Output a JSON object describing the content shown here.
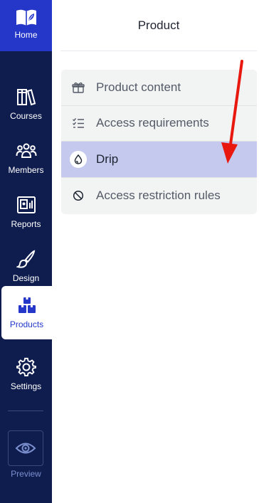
{
  "sidebar": {
    "home_label": "Home",
    "items": [
      {
        "label": "Courses",
        "icon": "books-icon"
      },
      {
        "label": "Members",
        "icon": "members-icon"
      },
      {
        "label": "Reports",
        "icon": "reports-icon"
      },
      {
        "label": "Design",
        "icon": "brush-icon"
      },
      {
        "label": "Products",
        "icon": "products-icon",
        "active": true
      },
      {
        "label": "Settings",
        "icon": "gear-icon"
      }
    ],
    "preview_label": "Preview"
  },
  "panel": {
    "title": "Product",
    "menu": [
      {
        "label": "Product content",
        "icon": "gift-box-icon"
      },
      {
        "label": "Access requirements",
        "icon": "checklist-icon"
      },
      {
        "label": "Drip",
        "icon": "droplet-icon",
        "selected": true
      },
      {
        "label": "Access restriction rules",
        "icon": "prohibited-icon"
      }
    ]
  },
  "colors": {
    "rail_bg": "#0f1d4e",
    "home_bg": "#2437c9",
    "accent": "#2437c9",
    "selected_row": "#c5c9ee",
    "annotation_arrow": "#e8180f"
  }
}
